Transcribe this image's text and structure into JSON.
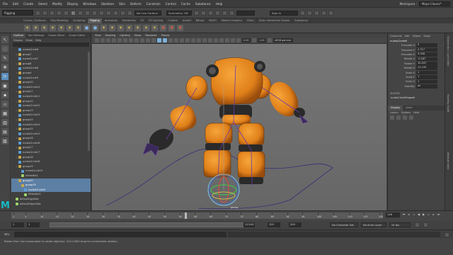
{
  "menubar": {
    "items": [
      "File",
      "Edit",
      "Create",
      "Select",
      "Modify",
      "Display",
      "Windows",
      "Skeleton",
      "Skin",
      "Deform",
      "Constrain",
      "Control",
      "Cache",
      "Substance",
      "Help"
    ],
    "workspace_label": "Workspace :",
    "workspace_value": "Maya Classic*"
  },
  "statusline": {
    "mode": "Rigging",
    "no_live_surface": "No Live Surface",
    "symmetry": "Symmetry: Off",
    "sign_in": "Sign In"
  },
  "shelf": {
    "tabs": [
      "Curves / Surfaces",
      "Poly Modeling",
      "Sculpting",
      "Rigging",
      "Animation",
      "Rendering",
      "FX",
      "FX Caching",
      "Custom",
      "Arnold",
      "Bifrost",
      "MASH",
      "Motion Graphics",
      "XGen",
      "XGen Interactive Groom",
      "Substance"
    ],
    "active_tab": "Rigging"
  },
  "outliner": {
    "tabs": [
      "Outliner",
      "Tool Settings",
      "Shape Editor",
      "Graph Editor"
    ],
    "active_tab": "Outliner",
    "menu": [
      "Display",
      "Show",
      "Help"
    ],
    "items": [
      {
        "label": "nurbsCircle6",
        "type": "crv",
        "indent": 1
      },
      {
        "label": "group7",
        "type": "grp",
        "indent": 1
      },
      {
        "label": "nurbsCircle7",
        "type": "crv",
        "indent": 1
      },
      {
        "label": "group8",
        "type": "grp",
        "indent": 1
      },
      {
        "label": "nurbsCircle8",
        "type": "crv",
        "indent": 1
      },
      {
        "label": "group9",
        "type": "grp",
        "indent": 1
      },
      {
        "label": "nurbsCircle9",
        "type": "crv",
        "indent": 1
      },
      {
        "label": "group10",
        "type": "grp",
        "indent": 1
      },
      {
        "label": "nurbsCircle10",
        "type": "crv",
        "indent": 1
      },
      {
        "label": "group11",
        "type": "grp",
        "indent": 1
      },
      {
        "label": "nurbsCircle11",
        "type": "crv",
        "indent": 1
      },
      {
        "label": "group12",
        "type": "grp",
        "indent": 1
      },
      {
        "label": "nurbsCircle12",
        "type": "crv",
        "indent": 1
      },
      {
        "label": "group13",
        "type": "grp",
        "indent": 1
      },
      {
        "label": "nurbsCircle13",
        "type": "crv",
        "indent": 1
      },
      {
        "label": "group14",
        "type": "grp",
        "indent": 1
      },
      {
        "label": "nurbsCircle14",
        "type": "crv",
        "indent": 1
      },
      {
        "label": "group15",
        "type": "grp",
        "indent": 1
      },
      {
        "label": "nurbsCircle15",
        "type": "crv",
        "indent": 1
      },
      {
        "label": "group16",
        "type": "grp",
        "indent": 1
      },
      {
        "label": "nurbsCircle16",
        "type": "crv",
        "indent": 1
      },
      {
        "label": "group17",
        "type": "grp",
        "indent": 1
      },
      {
        "label": "nurbsCircle17",
        "type": "crv",
        "indent": 1
      },
      {
        "label": "group18",
        "type": "grp",
        "indent": 1
      },
      {
        "label": "nurbsCircle18",
        "type": "crv",
        "indent": 1
      },
      {
        "label": "group19",
        "type": "grp",
        "indent": 1
      },
      {
        "label": "nurbsCircle19",
        "type": "crv",
        "indent": 2
      },
      {
        "label": "ikHandle1",
        "type": "loc",
        "indent": 2
      },
      {
        "label": "group20",
        "type": "grp",
        "indent": 1,
        "selected": true
      },
      {
        "label": "group19",
        "type": "grp",
        "indent": 2,
        "selected": true
      },
      {
        "label": "nurbsCircle20",
        "type": "crv",
        "indent": 3,
        "selected": true
      },
      {
        "label": "ikHandle2",
        "type": "loc",
        "indent": 3
      },
      {
        "label": "defaultLightSet",
        "type": "loc",
        "indent": 0
      },
      {
        "label": "defaultObjectSet",
        "type": "loc",
        "indent": 0
      }
    ]
  },
  "viewport": {
    "menu": [
      "View",
      "Shading",
      "Lighting",
      "Show",
      "Renderer",
      "Panels"
    ],
    "near_value": "0.00",
    "far_value": "1.00",
    "color_space": "sRGB gamma",
    "camera_label": "persp"
  },
  "channelbox": {
    "header": [
      "Channels",
      "Edit",
      "Object",
      "Show"
    ],
    "object_name": "nurbsCircle6",
    "channels": [
      {
        "name": "Translate X",
        "value": "0"
      },
      {
        "name": "Translate Y",
        "value": "2.717"
      },
      {
        "name": "Translate Z",
        "value": "3.326"
      },
      {
        "name": "Rotate X",
        "value": "-0.187"
      },
      {
        "name": "Rotate Y",
        "value": "10.247"
      },
      {
        "name": "Rotate Z",
        "value": "11.133"
      },
      {
        "name": "Scale X",
        "value": "1"
      },
      {
        "name": "Scale Y",
        "value": "1"
      },
      {
        "name": "Scale Z",
        "value": "1"
      },
      {
        "name": "Visibility",
        "value": "on"
      }
    ],
    "shapes_label": "SHAPES",
    "shape_name": "nurbsCircleShape6"
  },
  "layers": {
    "tabs": [
      "Display",
      "Anim"
    ],
    "active_tab": "Display",
    "menu": [
      "Layers",
      "Options",
      "Help"
    ]
  },
  "right_strip": {
    "tabs": [
      "Channel Box / Layer Editor",
      "Modeling Toolkit",
      "Attribute Editor"
    ]
  },
  "timeslider": {
    "ticks": [
      "1",
      "5",
      "10",
      "15",
      "20",
      "25",
      "30",
      "35",
      "40",
      "45",
      "50",
      "55",
      "60",
      "65",
      "70",
      "75",
      "80",
      "85",
      "90",
      "95",
      "100",
      "105",
      "110",
      "115",
      "120"
    ],
    "cursor_frame": 57,
    "current_frame": "116"
  },
  "rangeslider": {
    "start": "1",
    "start_inner": "1",
    "end_inner": "113.00",
    "end": "120",
    "end_outer": "200",
    "char_set": "No Character Set",
    "anim_layer": "No Anim Layer",
    "fps": "24 fps"
  },
  "cmdline": {
    "label": "MEL"
  },
  "helpline": {
    "text": "Rotate Tool: Use manipulator to rotate object(s). Ctrl+LMB+drag for constrained rotation."
  },
  "colors": {
    "robot_orange": "#e88a1e",
    "robot_dark": "#2a2a2a",
    "rig_purple": "#6b3aa8",
    "selection_blue": "#5d7fa4",
    "maya_teal": "#17b9c6"
  }
}
